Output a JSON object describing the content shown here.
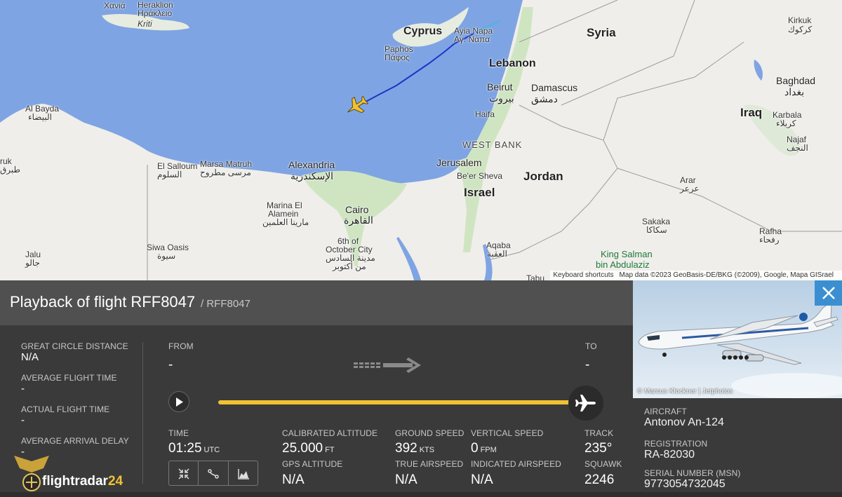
{
  "map": {
    "labels": {
      "chania": "Χανιά",
      "heraklion": "Heraklion",
      "heraklion_gr": "Ηράκλειο",
      "kriti": "Kriti",
      "cyprus": "Cyprus",
      "ayia_napa": "Ayia Napa",
      "ayia_napa_gr": "Αγ. Νάπα",
      "paphos": "Paphos",
      "paphos_gr": "Πάφος",
      "syria": "Syria",
      "kirkuk": "Kirkuk",
      "kirkuk_ar": "كركوك",
      "lebanon": "Lebanon",
      "beirut": "Beirut",
      "beirut_ar": "بيروت",
      "damascus": "Damascus",
      "damascus_ar": "دمشق",
      "baghdad": "Baghdad",
      "baghdad_ar": "بغداد",
      "iraq": "Iraq",
      "karbala": "Karbala",
      "karbala_ar": "كربلاء",
      "najaf": "Najaf",
      "najaf_ar": "النجف",
      "haifa": "Haifa",
      "west_bank": "WEST BANK",
      "al_bayda": "Al Bayda",
      "al_bayda_ar": "البيضاء",
      "tobruk": "ruk",
      "tobruk_ar": "طبرق",
      "el_salloum": "El Salloum",
      "el_salloum_ar": "السلوم",
      "marsa_matruh": "Marsa Matruh",
      "marsa_matruh_ar": "مرسى مطروح",
      "alexandria": "Alexandria",
      "alexandria_ar": "الإسكندرية",
      "jerusalem": "Jerusalem",
      "beer_sheva": "Be'er Sheva",
      "jordan": "Jordan",
      "israel": "Israel",
      "arar": "Arar",
      "arar_ar": "عرعر",
      "marina": "Marina El",
      "marina2": "Alamein",
      "marina_ar": "مارينا العلمين",
      "cairo": "Cairo",
      "cairo_ar": "القاهرة",
      "october": "6th of",
      "october2": "October City",
      "october_ar": "مدينة السادس",
      "october_ar2": "من أكتوبر",
      "siwa": "Siwa Oasis",
      "siwa_ar": "سيوة",
      "jalu": "Jalu",
      "jalu_ar": "جالو",
      "sakaka": "Sakaka",
      "sakaka_ar": "سكاكا",
      "rafha": "Rafha",
      "rafha_ar": "رفحاء",
      "aqaba": "Aqaba",
      "aqaba_ar": "العقبة",
      "tabuk": "Tabu",
      "park": "King Salman",
      "park2": "bin Abdulaziz"
    },
    "attribution": {
      "shortcuts": "Keyboard shortcuts",
      "data": "Map data ©2023 GeoBasis-DE/BKG (©2009), Google, Mapa GISrael"
    },
    "colors": {
      "sea": "#7fa4e3",
      "land": "#f0eeea",
      "fertile": "#cfe5c2",
      "route": "#1f35c8",
      "plane": "#f0c232"
    }
  },
  "panel": {
    "title": "Playback of flight RFF8047",
    "subtitle": "/ RFF8047",
    "stats": [
      {
        "label": "GREAT CIRCLE DISTANCE",
        "value": "N/A"
      },
      {
        "label": "AVERAGE FLIGHT TIME",
        "value": "-"
      },
      {
        "label": "ACTUAL FLIGHT TIME",
        "value": "-"
      },
      {
        "label": "AVERAGE ARRIVAL DELAY",
        "value": "-"
      }
    ],
    "from": {
      "label": "FROM",
      "value": "-"
    },
    "to": {
      "label": "TO",
      "value": "-"
    },
    "time": {
      "label": "TIME",
      "value": "01:25",
      "unit": "UTC"
    },
    "calibrated_altitude": {
      "label": "CALIBRATED ALTITUDE",
      "value": "25.000",
      "unit": "FT"
    },
    "gps_altitude": {
      "label": "GPS ALTITUDE",
      "value": "N/A"
    },
    "ground_speed": {
      "label": "GROUND SPEED",
      "value": "392",
      "unit": "KTS"
    },
    "true_airspeed": {
      "label": "TRUE AIRSPEED",
      "value": "N/A"
    },
    "vertical_speed": {
      "label": "VERTICAL SPEED",
      "value": "0",
      "unit": "FPM"
    },
    "indicated_airspeed": {
      "label": "INDICATED AIRSPEED",
      "value": "N/A"
    },
    "track": {
      "label": "TRACK",
      "value": "235°"
    },
    "squawk": {
      "label": "SQUAWK",
      "value": "2246"
    },
    "playback_progress": 1.0,
    "logo": {
      "prefix": "flightradar",
      "suffix": "24"
    }
  },
  "aircraft_info": {
    "photo_credit": "© Marcus Klockner | Jetphotos",
    "aircraft": {
      "label": "AIRCRAFT",
      "value": "Antonov An-124"
    },
    "registration": {
      "label": "REGISTRATION",
      "value": "RA-82030"
    },
    "serial": {
      "label": "SERIAL NUMBER (MSN)",
      "value": "9773054732045"
    }
  }
}
